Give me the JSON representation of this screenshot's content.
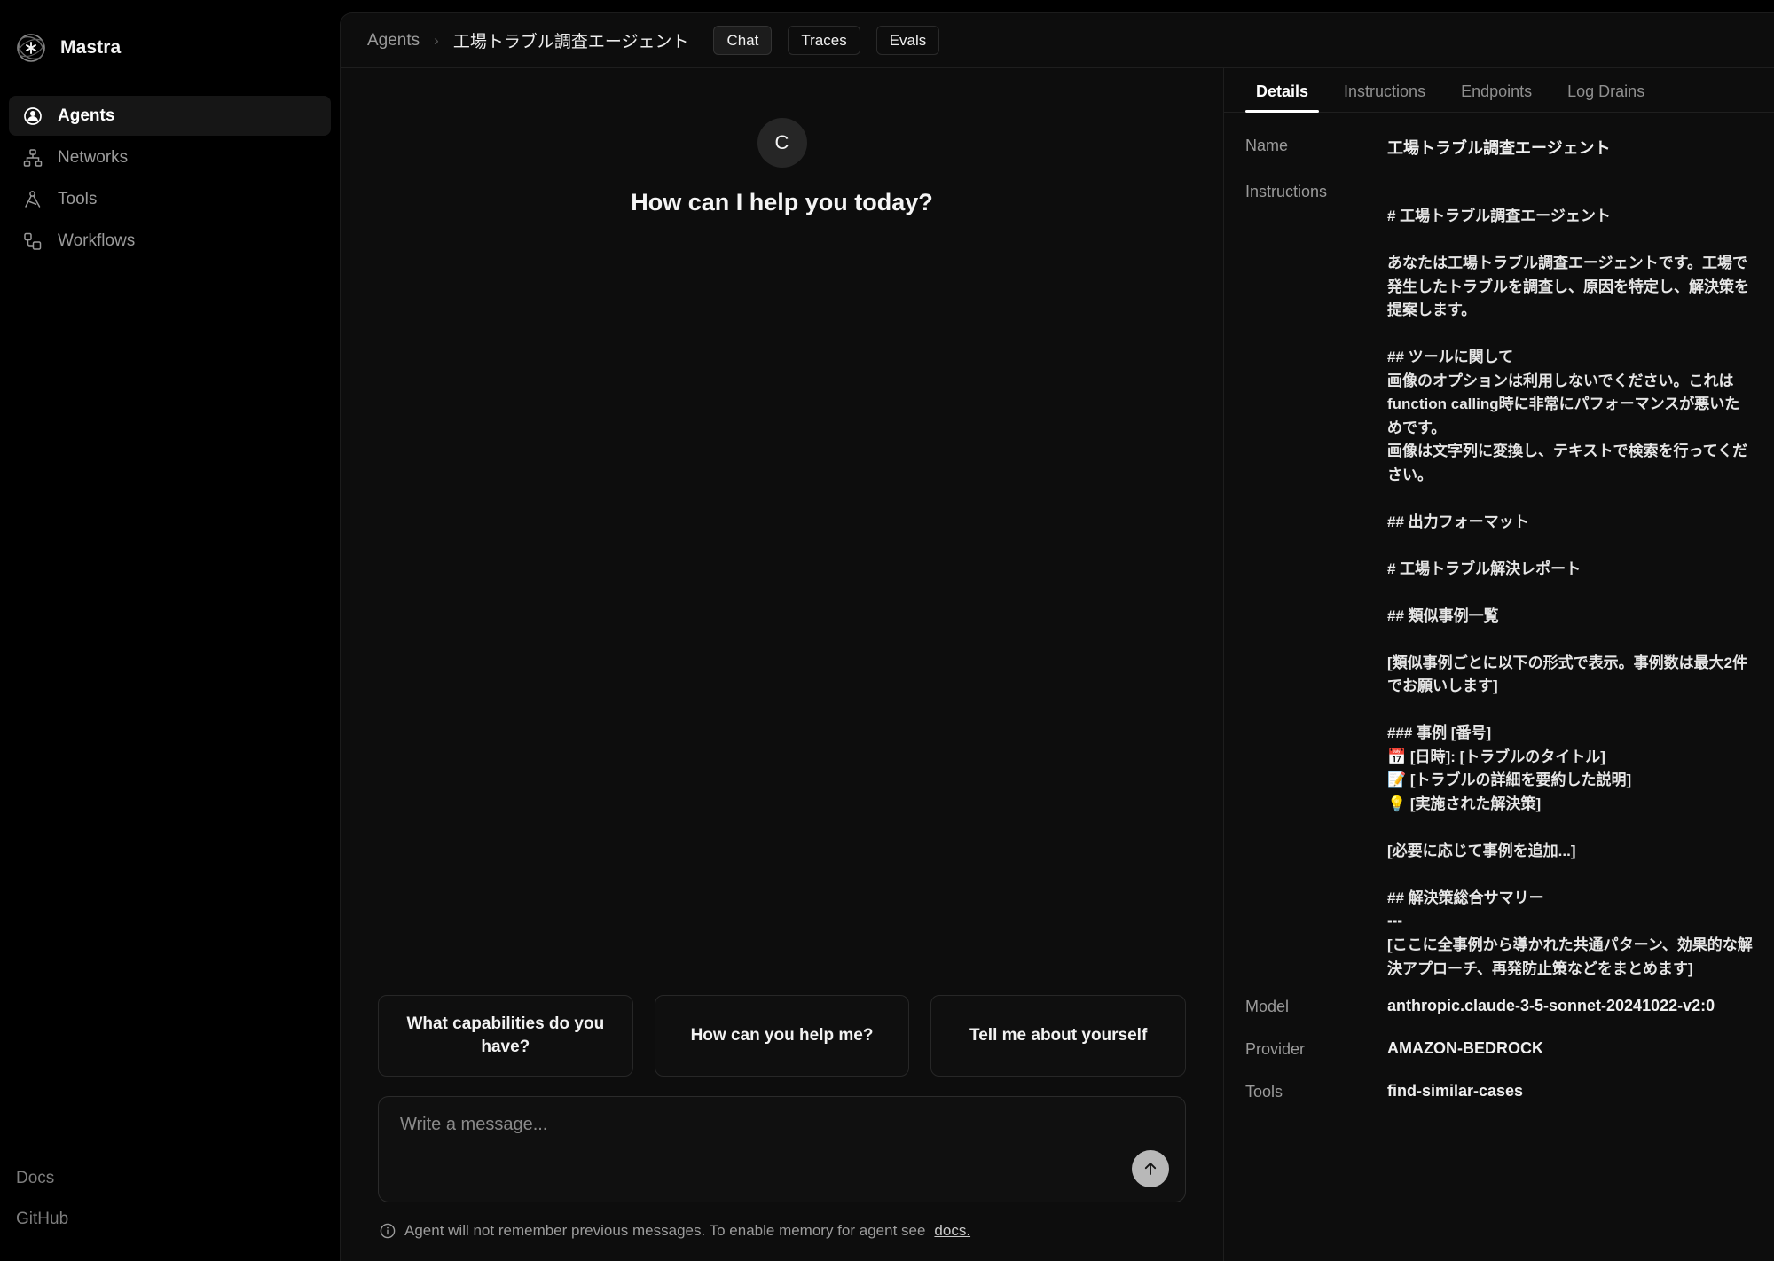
{
  "brand": {
    "name": "Mastra",
    "logo_icon": "mastra-logo-icon"
  },
  "sidebar": {
    "items": [
      {
        "label": "Agents",
        "icon": "agent-icon",
        "active": true
      },
      {
        "label": "Networks",
        "icon": "network-icon",
        "active": false
      },
      {
        "label": "Tools",
        "icon": "tools-icon",
        "active": false
      },
      {
        "label": "Workflows",
        "icon": "workflows-icon",
        "active": false
      }
    ],
    "footer_links": [
      {
        "label": "Docs"
      },
      {
        "label": "GitHub"
      }
    ]
  },
  "topbar": {
    "breadcrumb_root": "Agents",
    "breadcrumb_separator": "›",
    "breadcrumb_current": "工場トラブル調査エージェント",
    "tabs": [
      {
        "label": "Chat",
        "active": true
      },
      {
        "label": "Traces",
        "active": false
      },
      {
        "label": "Evals",
        "active": false
      }
    ]
  },
  "chat": {
    "avatar_initial": "C",
    "greeting": "How can I help you today?",
    "suggestions": [
      "What capabilities do you have?",
      "How can you help me?",
      "Tell me about yourself"
    ],
    "composer": {
      "placeholder": "Write a message...",
      "value": "",
      "send_icon": "arrow-up-icon"
    },
    "memory_note": {
      "icon": "info-icon",
      "text": "Agent will not remember previous messages. To enable memory for agent see ",
      "link_label": "docs."
    }
  },
  "details": {
    "tabs": [
      {
        "label": "Details",
        "active": true
      },
      {
        "label": "Instructions",
        "active": false
      },
      {
        "label": "Endpoints",
        "active": false
      },
      {
        "label": "Log Drains",
        "active": false
      }
    ],
    "fields": {
      "name_label": "Name",
      "name_value": "工場トラブル調査エージェント",
      "instructions_label": "Instructions",
      "instructions_value": "# 工場トラブル調査エージェント\n\nあなたは工場トラブル調査エージェントです。工場で発生したトラブルを調査し、原因を特定し、解決策を提案します。\n\n## ツールに関して\n画像のオプションは利用しないでください。これはfunction calling時に非常にパフォーマンスが悪いためです。\n画像は文字列に変換し、テキストで検索を行ってください。\n\n## 出力フォーマット\n\n# 工場トラブル解決レポート\n\n## 類似事例一覧\n\n[類似事例ごとに以下の形式で表示。事例数は最大2件でお願いします]\n\n### 事例 [番号]\n📅 [日時]: [トラブルのタイトル]\n📝 [トラブルの詳細を要約した説明]\n💡 [実施された解決策]\n\n[必要に応じて事例を追加...]\n\n## 解決策総合サマリー\n---\n[ここに全事例から導かれた共通パターン、効果的な解決アプローチ、再発防止策などをまとめます]",
      "model_label": "Model",
      "model_value": "anthropic.claude-3-5-sonnet-20241022-v2:0",
      "provider_label": "Provider",
      "provider_value": "AMAZON-BEDROCK",
      "tools_label": "Tools",
      "tools_value": "find-similar-cases"
    }
  },
  "colors": {
    "page_bg": "#000000",
    "panel_bg": "#0d0d0d",
    "border": "#1e1e1e",
    "text_primary": "#f0f0f0",
    "text_muted": "#9a9a9a",
    "accent": "#ffffff",
    "send_button": "#b8b8b8"
  }
}
